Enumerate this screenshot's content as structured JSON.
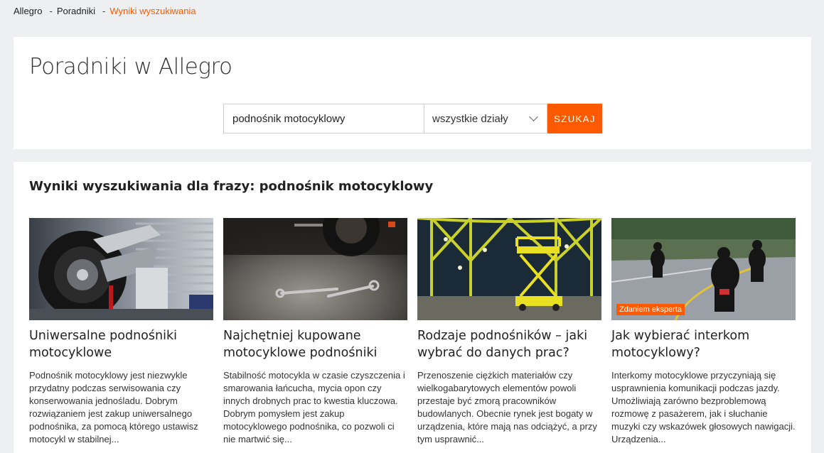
{
  "breadcrumb": {
    "items": [
      "Allegro",
      "Poradniki",
      "Wyniki wyszukiwania"
    ],
    "separator": "-"
  },
  "header": {
    "title": "Poradniki w Allegro"
  },
  "search": {
    "value": "podnośnik motocyklowy",
    "category": "wszystkie działy",
    "button_label": "SZUKAJ"
  },
  "results": {
    "heading": "Wyniki wyszukiwania dla frazy: podnośnik motocyklowy",
    "cards": [
      {
        "title": "Uniwersalne podnośniki motocyklowe",
        "description": "Podnośnik motocyklowy jest niezwykle przydatny podczas serwisowania czy konserwowania jednośladu. Dobrym rozwiązaniem jest zakup uniwersalnego podnośnika, za pomocą którego ustawisz motocykl w stabilnej...",
        "badge": "",
        "image_icon": "motorcycle-on-lift-photo"
      },
      {
        "title": "Najchętniej kupowane motocyklowe podnośniki",
        "description": "Stabilność motocykla w czasie czyszczenia i smarowania łańcucha, mycia opon czy innych drobnych prac to kwestia kluczowa. Dobrym pomysłem jest zakup motocyklowego podnośnika, co pozwoli ci nie martwić się...",
        "badge": "",
        "image_icon": "wrenches-on-floor-photo"
      },
      {
        "title": "Rodzaje podnośników – jaki wybrać do danych prac?",
        "description": "Przenoszenie ciężkich materiałów czy wielkogabarytowych elementów powoli przestaje być zmorą pracowników budowlanych. Obecnie rynek jest bogaty w urządzenia, które mają nas odciążyć, a przy tym usprawnić...",
        "badge": "",
        "image_icon": "scissor-lift-photo"
      },
      {
        "title": "Jak wybierać interkom motocyklowy?",
        "description": "Interkomy motocyklowe przyczyniają się usprawnienia komunikacji podczas jazdy. Umożliwiają zarówno bezproblemową rozmowę z pasażerem, jak i słuchanie muzyki czy wskazówek głosowych nawigacji. Urządzenia...",
        "badge": "Zdaniem eksperta",
        "image_icon": "motorcyclists-on-road-photo"
      }
    ]
  },
  "colors": {
    "accent": "#ff5a00",
    "background": "#eeeff1",
    "panel": "#ffffff"
  }
}
